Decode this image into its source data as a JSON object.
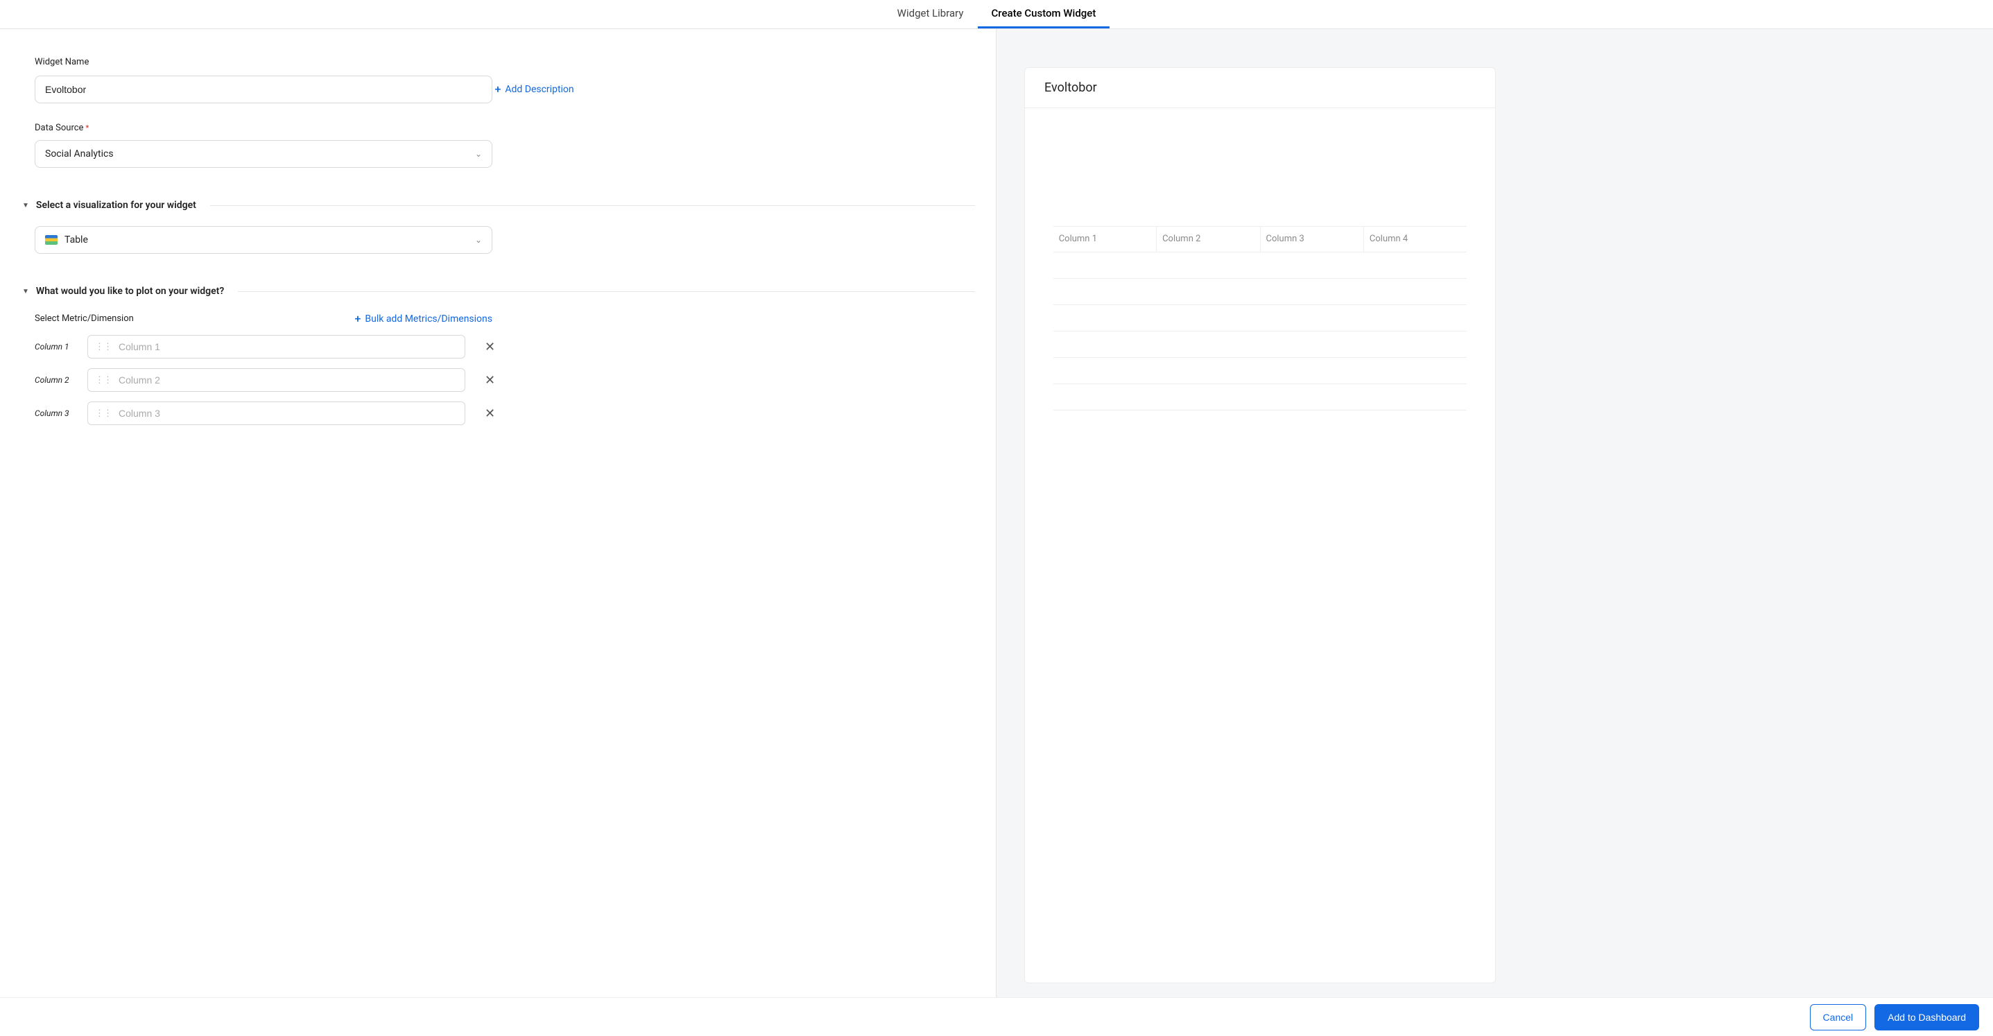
{
  "tabs": {
    "library": "Widget Library",
    "create": "Create Custom Widget"
  },
  "form": {
    "widget_name_label": "Widget Name",
    "widget_name_value": "Evoltobor",
    "add_description": "Add Description",
    "data_source_label": "Data Source",
    "data_source_value": "Social Analytics",
    "viz_section_title": "Select a visualization for your widget",
    "viz_value": "Table",
    "plot_section_title": "What would you like to plot on your widget?",
    "select_metric_label": "Select Metric/Dimension",
    "bulk_add_label": "Bulk add Metrics/Dimensions",
    "columns": [
      {
        "label": "Column 1",
        "placeholder": "Column 1"
      },
      {
        "label": "Column 2",
        "placeholder": "Column 2"
      },
      {
        "label": "Column 3",
        "placeholder": "Column 3"
      }
    ]
  },
  "preview": {
    "title": "Evoltobor",
    "headers": [
      "Column 1",
      "Column 2",
      "Column 3",
      "Column 4"
    ]
  },
  "footer": {
    "cancel": "Cancel",
    "add": "Add to Dashboard"
  },
  "chart_data": {
    "type": "table",
    "title": "Evoltobor",
    "columns": [
      "Column 1",
      "Column 2",
      "Column 3",
      "Column 4"
    ],
    "rows": [
      [
        "",
        "",
        "",
        ""
      ],
      [
        "",
        "",
        "",
        ""
      ],
      [
        "",
        "",
        "",
        ""
      ],
      [
        "",
        "",
        "",
        ""
      ],
      [
        "",
        "",
        "",
        ""
      ],
      [
        "",
        "",
        "",
        ""
      ]
    ]
  }
}
